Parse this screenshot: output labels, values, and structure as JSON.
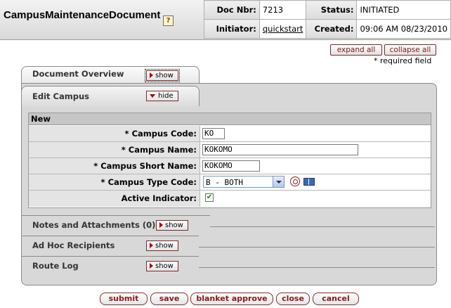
{
  "header": {
    "title": "CampusMaintenanceDocument",
    "help_icon": "?",
    "doc_nbr_label": "Doc Nbr:",
    "doc_nbr": "7213",
    "status_label": "Status:",
    "status": "INITIATED",
    "initiator_label": "Initiator:",
    "initiator": "quickstart",
    "created_label": "Created:",
    "created": "09:06 AM 08/23/2010"
  },
  "controls": {
    "expand_all": "expand all",
    "collapse_all": "collapse all",
    "required_note": "* required field"
  },
  "tabs": [
    {
      "label": "Document Overview",
      "toggle": "show"
    },
    {
      "label": "Edit Campus",
      "toggle": "hide"
    },
    {
      "label": "Notes and Attachments (0)",
      "toggle": "show"
    },
    {
      "label": "Ad Hoc Recipients",
      "toggle": "show"
    },
    {
      "label": "Route Log",
      "toggle": "show"
    }
  ],
  "edit_campus": {
    "section_header": "New",
    "fields": {
      "campus_code": {
        "label": "*  Campus Code:",
        "value": "KO"
      },
      "campus_name": {
        "label": "*  Campus Name:",
        "value": "KOKOMO"
      },
      "campus_short_name": {
        "label": "*  Campus Short Name:",
        "value": "KOKOMO"
      },
      "campus_type_code": {
        "label": "*  Campus Type Code:",
        "value": "B - BOTH"
      },
      "active_indicator": {
        "label": "Active Indicator:",
        "checked": true,
        "check_glyph": "✔"
      }
    }
  },
  "buttons": {
    "submit": "submit",
    "save": "save",
    "blanket_approve": "blanket approve",
    "close": "close",
    "cancel": "cancel"
  },
  "colors": {
    "button_text": "#8a1a1a",
    "panel_bg": "#d8d8d8"
  }
}
